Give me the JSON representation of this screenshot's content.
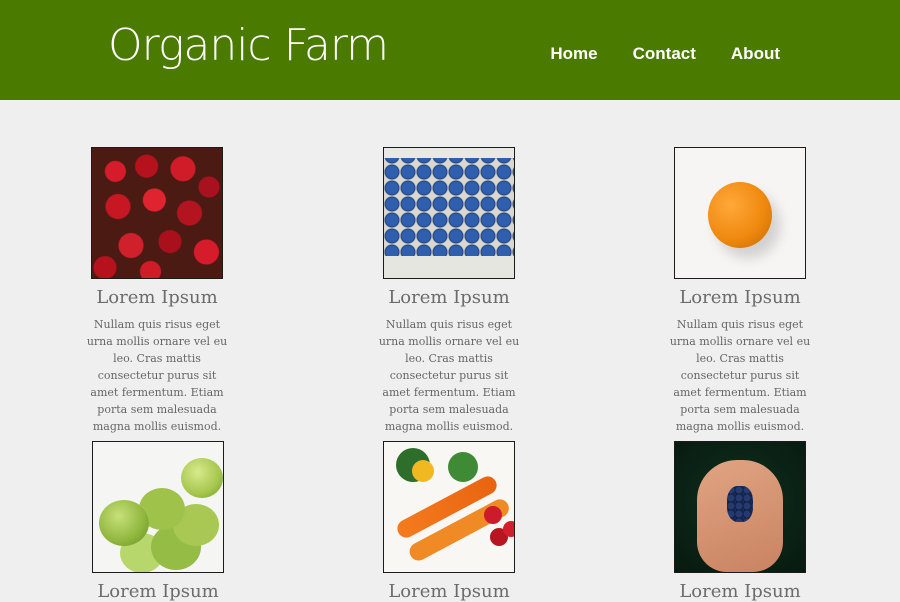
{
  "header": {
    "logo": "Organic Farm",
    "nav": [
      "Home",
      "Contact",
      "About"
    ],
    "colors": {
      "background": "#4a7a00",
      "text": "#ffffff"
    }
  },
  "products": [
    {
      "image": "strawberries",
      "title": "Lorem Ipsum",
      "description": "Nullam quis risus eget urna mollis ornare vel eu leo. Cras mattis consectetur purus sit amet fermentum. Etiam porta sem malesuada magna mollis euismod."
    },
    {
      "image": "blueberries",
      "title": "Lorem Ipsum",
      "description": "Nullam quis risus eget urna mollis ornare vel eu leo. Cras mattis consectetur purus sit amet fermentum. Etiam porta sem malesuada magna mollis euismod."
    },
    {
      "image": "orange",
      "title": "Lorem Ipsum",
      "description": "Nullam quis risus eget urna mollis ornare vel eu leo. Cras mattis consectetur purus sit amet fermentum. Etiam porta sem malesuada magna mollis euismod."
    },
    {
      "image": "green-apples",
      "title": "Lorem Ipsum"
    },
    {
      "image": "vegetables",
      "title": "Lorem Ipsum"
    },
    {
      "image": "hand-with-berries",
      "title": "Lorem Ipsum"
    }
  ]
}
